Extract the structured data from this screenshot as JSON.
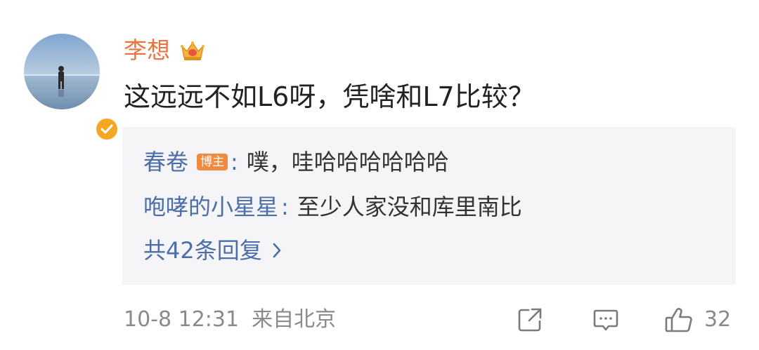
{
  "comment": {
    "username": "李想",
    "text": "这远远不如L6呀，凭啥和L7比较？",
    "timestamp": "10-8 12:31",
    "location": "来自北京",
    "like_count": "32",
    "avatar_icon": "user-avatar-photo",
    "verified_icon": "verified-badge",
    "crown_icon": "vip-crown-icon"
  },
  "replies": [
    {
      "name": "春卷",
      "tag": "博主",
      "colon": ":",
      "text": "噗，哇哈哈哈哈哈哈"
    },
    {
      "name": "咆哮的小星星",
      "colon": ":",
      "text": "至少人家没和库里南比"
    }
  ],
  "more_replies": {
    "label": "共42条回复"
  },
  "colors": {
    "username": "#eb7340",
    "link_blue": "#4b6ea8",
    "meta_gray": "#8a8a8a",
    "reply_box_bg": "#f5f5f7",
    "author_tag_bg": "#f08a3c",
    "verified_badge": "#f5a623"
  }
}
